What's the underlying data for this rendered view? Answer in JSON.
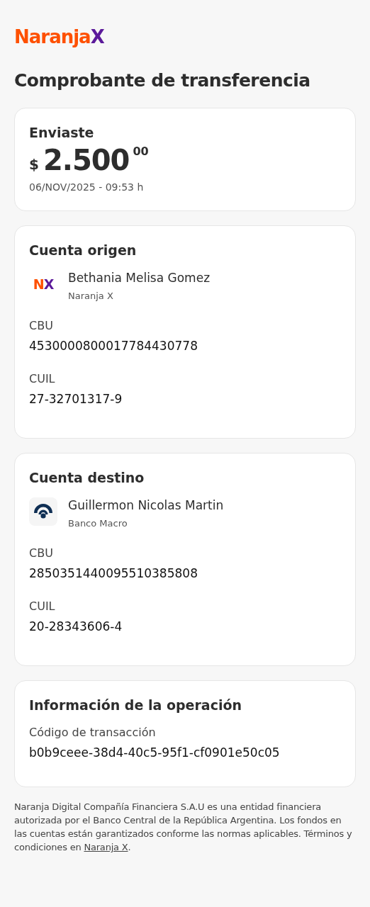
{
  "logo": "NaranjaX",
  "title": "Comprobante de transferencia",
  "amount_card": {
    "label": "Enviaste",
    "currency": "$",
    "amount": "2.500",
    "cents": "00",
    "date": "06/NOV/2025 - 09:53 h"
  },
  "accounts": [
    {
      "title": "Cuenta origen",
      "kind": "naranja",
      "bank_logo": "NX",
      "holder": "Bethania Melisa Gomez",
      "bank": "Naranja X",
      "fields": [
        {
          "label": "CBU",
          "value": "4530000800017784430778"
        },
        {
          "label": "CUIL",
          "value": "27-32701317-9"
        }
      ]
    },
    {
      "title": "Cuenta destino",
      "kind": "macro",
      "holder": "Guillermon Nicolas Martin",
      "bank": "Banco Macro",
      "fields": [
        {
          "label": "CBU",
          "value": "2850351440095510385808"
        },
        {
          "label": "CUIL",
          "value": "20-28343606-4"
        }
      ]
    }
  ],
  "operation": {
    "title": "Información de la operación",
    "fields": [
      {
        "label": "Código de transacción",
        "value": "b0b9ceee-38d4-40c5-95f1-cf0901e50c05"
      }
    ]
  },
  "footer": {
    "text": "Naranja Digital Compañía Financiera S.A.U es una entidad financiera autorizada por el Banco Central de la República Argentina. Los fondos en las cuentas están garantizados conforme las normas aplicables. Términos y condiciones en ",
    "link": "Naranja X",
    "after": "."
  }
}
